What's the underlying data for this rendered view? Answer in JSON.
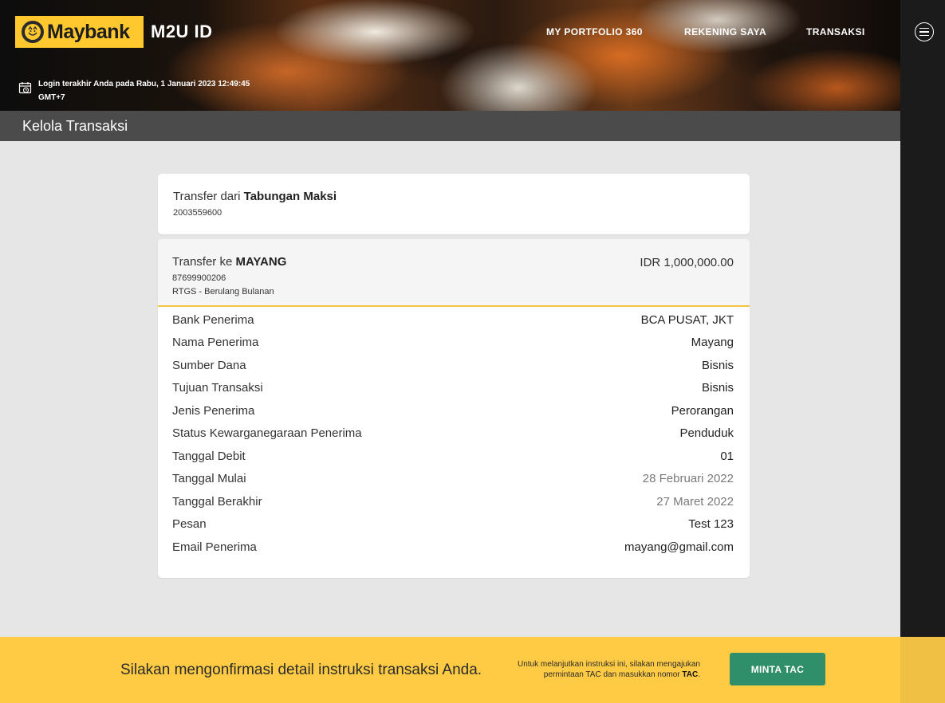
{
  "header": {
    "logo_text": "Maybank",
    "app_name": "M2U ID",
    "nav": [
      {
        "label": "MY PORTFOLIO 360"
      },
      {
        "label": "REKENING SAYA"
      },
      {
        "label": "TRANSAKSI"
      }
    ],
    "last_login_line1": "Login terakhir Anda pada Rabu, 1 Januari 2023 12:49:45",
    "last_login_line2": "GMT+7"
  },
  "title_bar": {
    "title": "Kelola Transaksi"
  },
  "from_card": {
    "prefix": "Transfer dari ",
    "account_name": "Tabungan Maksi",
    "account_number": "2003559600"
  },
  "to_card": {
    "prefix": "Transfer ke ",
    "recipient": "MAYANG",
    "account_number": "87699900206",
    "transfer_type": "RTGS - Berulang Bulanan",
    "amount": "IDR 1,000,000.00",
    "details": [
      {
        "label": "Bank Penerima",
        "value": "BCA PUSAT, JKT"
      },
      {
        "label": "Nama Penerima",
        "value": "Mayang"
      },
      {
        "label": "Sumber Dana",
        "value": "Bisnis"
      },
      {
        "label": "Tujuan Transaksi",
        "value": "Bisnis"
      },
      {
        "label": "Jenis Penerima",
        "value": "Perorangan"
      },
      {
        "label": "Status Kewarganegaraan Penerima",
        "value": "Penduduk"
      },
      {
        "label": "Tanggal Debit",
        "value": "01"
      },
      {
        "label": "Tanggal Mulai",
        "value": "28 Februari 2022"
      },
      {
        "label": "Tanggal Berakhir",
        "value": "27 Maret 2022"
      },
      {
        "label": "Pesan",
        "value": "Test 123"
      },
      {
        "label": "Email Penerima",
        "value": "mayang@gmail.com"
      }
    ]
  },
  "footer": {
    "message": "Silakan mengonfirmasi detail instruksi transaksi Anda.",
    "note_line1": "Untuk melanjutkan instruksi ini, silakan mengajukan",
    "note_line2_prefix": "permintaan TAC dan masukkan nomor ",
    "note_bold": "TAC",
    "note_suffix": ".",
    "button_label": "MINTA TAC"
  },
  "colors": {
    "brand_yellow": "#ffc82e",
    "footer_yellow": "#ffcb45",
    "title_bar": "#4b4b4b",
    "tac_button": "#2f8f6b",
    "right_rail": "#1b1b1b",
    "divider_accent": "#f4c542"
  }
}
